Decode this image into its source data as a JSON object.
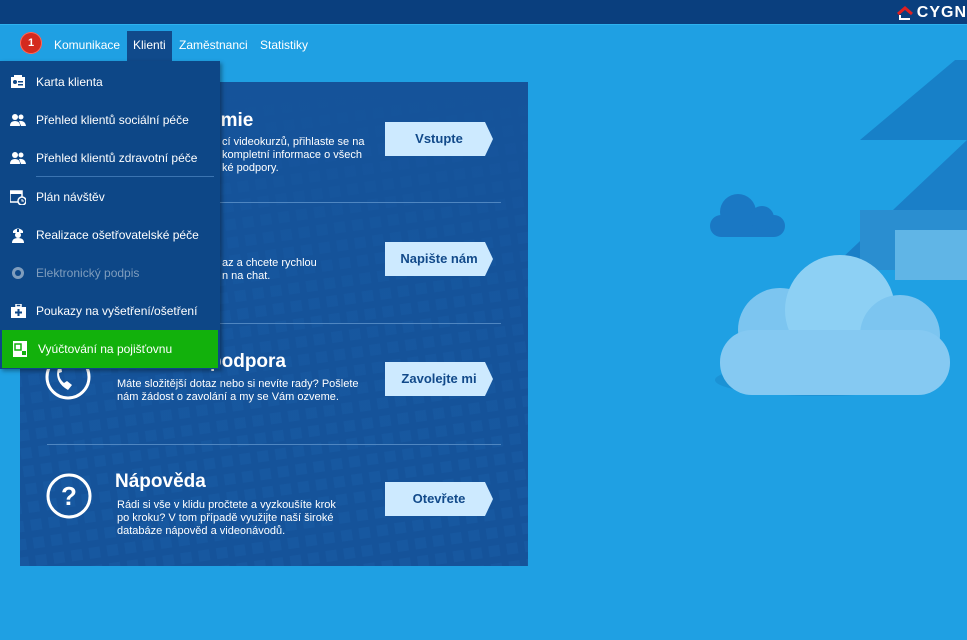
{
  "app": {
    "brand": "CYGN"
  },
  "nav": {
    "notification_count": "1",
    "tabs": [
      {
        "label": "Komunikace"
      },
      {
        "label": "Klienti"
      },
      {
        "label": "Zaměstnanci"
      },
      {
        "label": "Statistiky"
      }
    ]
  },
  "menu": {
    "items": [
      {
        "label": "Karta klienta",
        "icon": "client-card-icon"
      },
      {
        "label": "Přehled klientů sociální péče",
        "icon": "users-icon"
      },
      {
        "label": "Přehled klientů zdravotní péče",
        "icon": "users-icon"
      },
      {
        "label": "Plán návštěv",
        "icon": "calendar-clock-icon"
      },
      {
        "label": "Realizace ošetřovatelské péče",
        "icon": "nurse-icon"
      },
      {
        "label": "Elektronický podpis",
        "icon": "seal-icon"
      },
      {
        "label": "Poukazy na vyšetření/ošetření",
        "icon": "medical-kit-icon"
      },
      {
        "label": "Vyúčtování na pojišťovnu",
        "icon": "billing-icon"
      }
    ]
  },
  "sections": [
    {
      "title": "emie",
      "text": [
        "cí videokurzů, přihlaste se na",
        "kompletní informace o všech",
        "ké podpory."
      ],
      "button": "Vstupte"
    },
    {
      "title": "",
      "text": [
        "az a chcete rychlou",
        "n na chat."
      ],
      "button": "Napište nám"
    },
    {
      "title": "podpora",
      "text": [
        "Máte složitější dotaz nebo si nevíte rady? Pošlete",
        "nám žádost o zavolání a my se Vám ozveme."
      ],
      "button": "Zavolejte mi"
    },
    {
      "title": "Nápověda",
      "text": [
        "Rádi si vše v klidu pročtete a vyzkoušíte krok",
        "po kroku? V tom případě využijte naší široké",
        "databáze nápověd a videonávodů."
      ],
      "button": "Otevřete"
    }
  ],
  "colors": {
    "background": "#1fa0e3",
    "titlebar": "#0a3f7e",
    "menu": "#0d4787",
    "panel": "#15539a",
    "selected": "#12b10c",
    "button": "#cdeaff",
    "badge": "#d42a1e"
  }
}
